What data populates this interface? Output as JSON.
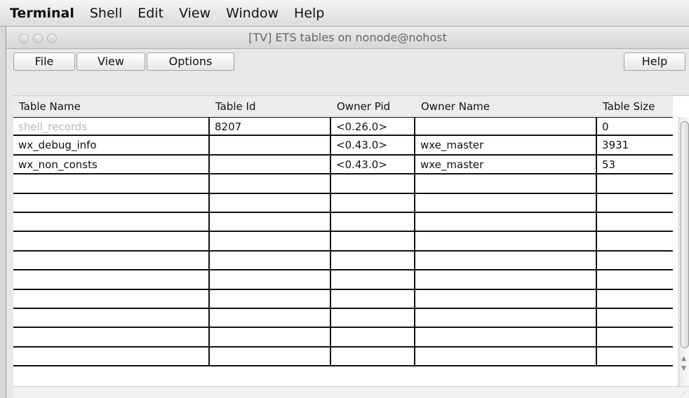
{
  "menubar": {
    "items": [
      "Terminal",
      "Shell",
      "Edit",
      "View",
      "Window",
      "Help"
    ]
  },
  "window": {
    "title": "[TV]  ETS tables on nonode@nohost"
  },
  "toolbar": {
    "file_label": "File",
    "view_label": "View",
    "options_label": "Options",
    "help_label": "Help"
  },
  "table": {
    "columns": [
      "Table Name",
      "Table Id",
      "Owner Pid",
      "Owner Name",
      "Table Size"
    ],
    "rows": [
      [
        "shell_records",
        "8207",
        "<0.26.0>",
        "",
        "0"
      ],
      [
        "wx_debug_info",
        "",
        "<0.43.0>",
        "wxe_master",
        "3931"
      ],
      [
        "wx_non_consts",
        "",
        "<0.43.0>",
        "wxe_master",
        "53"
      ],
      [
        "",
        "",
        "",
        "",
        ""
      ],
      [
        "",
        "",
        "",
        "",
        ""
      ],
      [
        "",
        "",
        "",
        "",
        ""
      ],
      [
        "",
        "",
        "",
        "",
        ""
      ],
      [
        "",
        "",
        "",
        "",
        ""
      ],
      [
        "",
        "",
        "",
        "",
        ""
      ],
      [
        "",
        "",
        "",
        "",
        ""
      ],
      [
        "",
        "",
        "",
        "",
        ""
      ],
      [
        "",
        "",
        "",
        "",
        ""
      ],
      [
        "",
        "",
        "",
        "",
        ""
      ]
    ]
  },
  "icons": {
    "close": "close-icon",
    "minimize": "minimize-icon",
    "zoom": "zoom-icon"
  }
}
